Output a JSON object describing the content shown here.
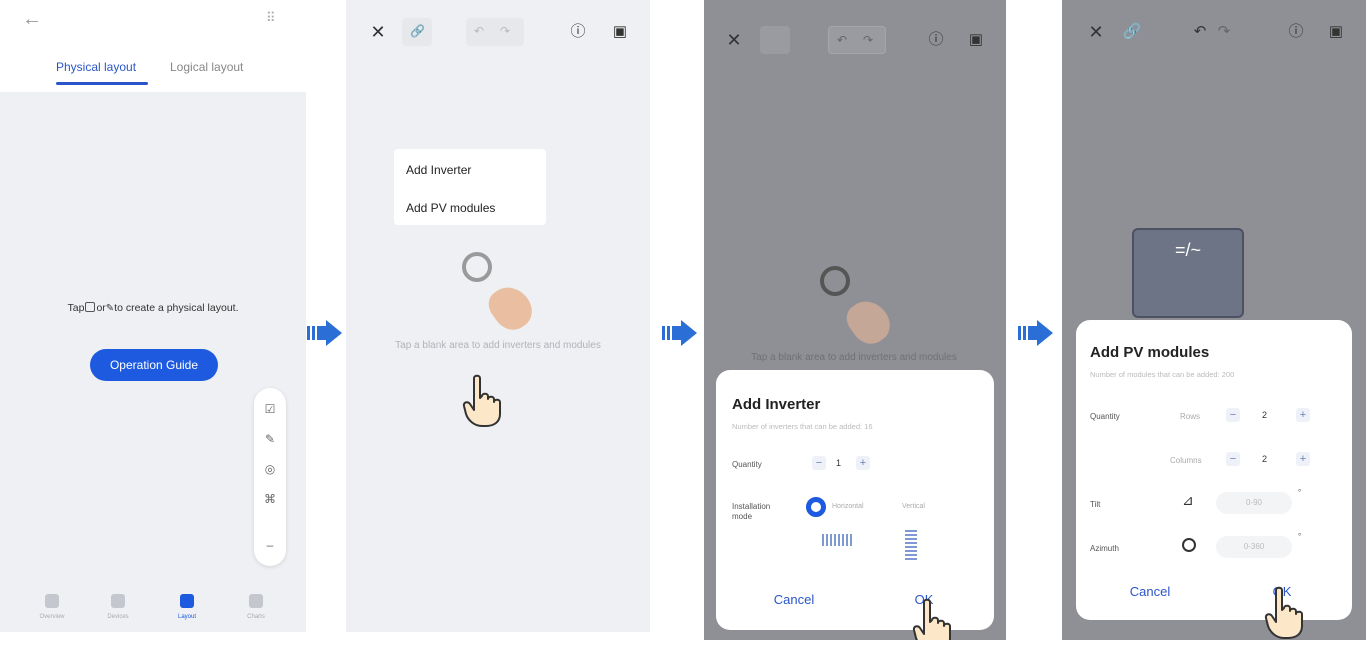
{
  "colors": {
    "accent": "#2a55c8",
    "primary_button": "#1d5ae0",
    "arrow": "#2b6ed6",
    "overlay_bg": "#8f9096"
  },
  "panel1": {
    "tabs": [
      "Physical layout",
      "Logical layout"
    ],
    "message_prefix": "Tap",
    "message_mid": "or",
    "message_suffix": "to create a physical layout.",
    "guide_button": "Operation Guide",
    "toolbar_icons": [
      "checkbox-icon",
      "pencil-icon",
      "layers-icon",
      "grid-icon",
      "minus-icon"
    ],
    "nav": [
      "Overview",
      "Devices",
      "Layout",
      "Charts"
    ]
  },
  "panel2": {
    "menu": [
      "Add Inverter",
      "Add PV modules"
    ],
    "hint": "Tap a blank area to add inverters and modules"
  },
  "panel3": {
    "hint": "Tap a blank area to add inverters and modules",
    "title": "Add Inverter",
    "subtitle": "Number of inverters that can be added: 16",
    "quantity_label": "Quantity",
    "quantity_value": "1",
    "install_label": "Installation mode",
    "install_options": [
      "Horizontal",
      "Vertical"
    ],
    "cancel": "Cancel",
    "ok": "OK"
  },
  "panel4": {
    "title": "Add PV modules",
    "subtitle": "Number of modules that can be added: 200",
    "quantity_label": "Quantity",
    "rows_label": "Rows",
    "rows_value": "2",
    "columns_label": "Columns",
    "columns_value": "2",
    "tilt_label": "Tilt",
    "azimuth_label": "Azimuth",
    "tilt_placeholder": "0-90",
    "azimuth_placeholder": "0-360",
    "degree": "°",
    "inverter_symbol": "=/~",
    "cancel": "Cancel",
    "ok": "OK"
  }
}
